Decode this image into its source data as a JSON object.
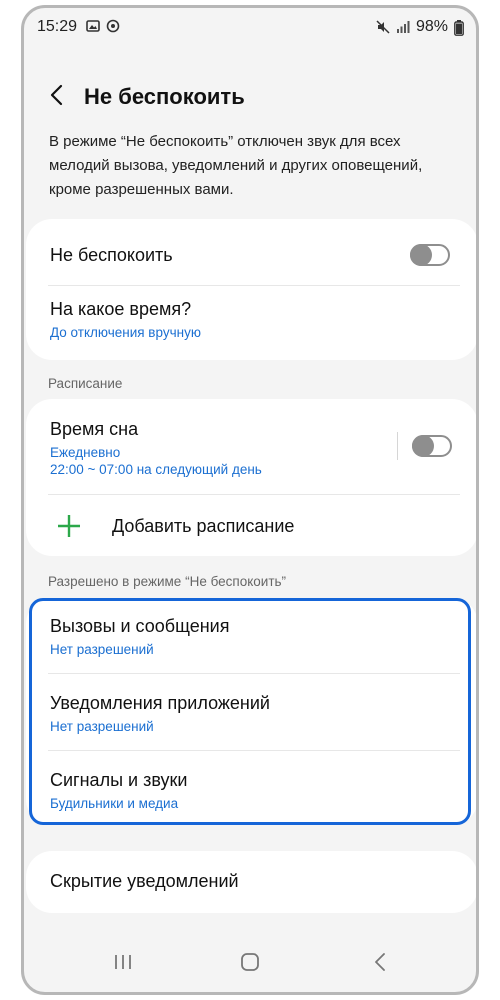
{
  "status_bar": {
    "time": "15:29",
    "battery": "98%",
    "icons": [
      "image-icon",
      "sync-icon",
      "mute-icon",
      "signal-icon",
      "battery-icon"
    ]
  },
  "header": {
    "title": "Не беспокоить",
    "back_icon": "chevron-left-icon"
  },
  "description": "В режиме “Не беспокоить” отключен звук для всех мелодий вызова, уведомлений и других оповещений, кроме разрешенных вами.",
  "main_toggle": {
    "label": "Не беспокоить",
    "on": false
  },
  "duration": {
    "title": "На какое время?",
    "value": "До отключения вручную"
  },
  "schedule": {
    "section_label": "Расписание",
    "sleep": {
      "title": "Время сна",
      "days": "Ежедневно",
      "time": "22:00 ~ 07:00 на следующий день",
      "on": false
    },
    "add_label": "Добавить расписание"
  },
  "allowed": {
    "section_label": "Разрешено в режиме “Не беспокоить”",
    "items": [
      {
        "title": "Вызовы и сообщения",
        "value": "Нет разрешений"
      },
      {
        "title": "Уведомления приложений",
        "value": "Нет разрешений"
      },
      {
        "title": "Сигналы и звуки",
        "value": "Будильники и медиа"
      }
    ]
  },
  "hide_notifications": {
    "title": "Скрытие уведомлений"
  },
  "colors": {
    "accent_blue": "#1b6fd1",
    "highlight_border": "#1565d8",
    "add_plus_green": "#2ca84a"
  },
  "nav_icons": [
    "recent-apps-icon",
    "home-icon",
    "back-icon"
  ]
}
